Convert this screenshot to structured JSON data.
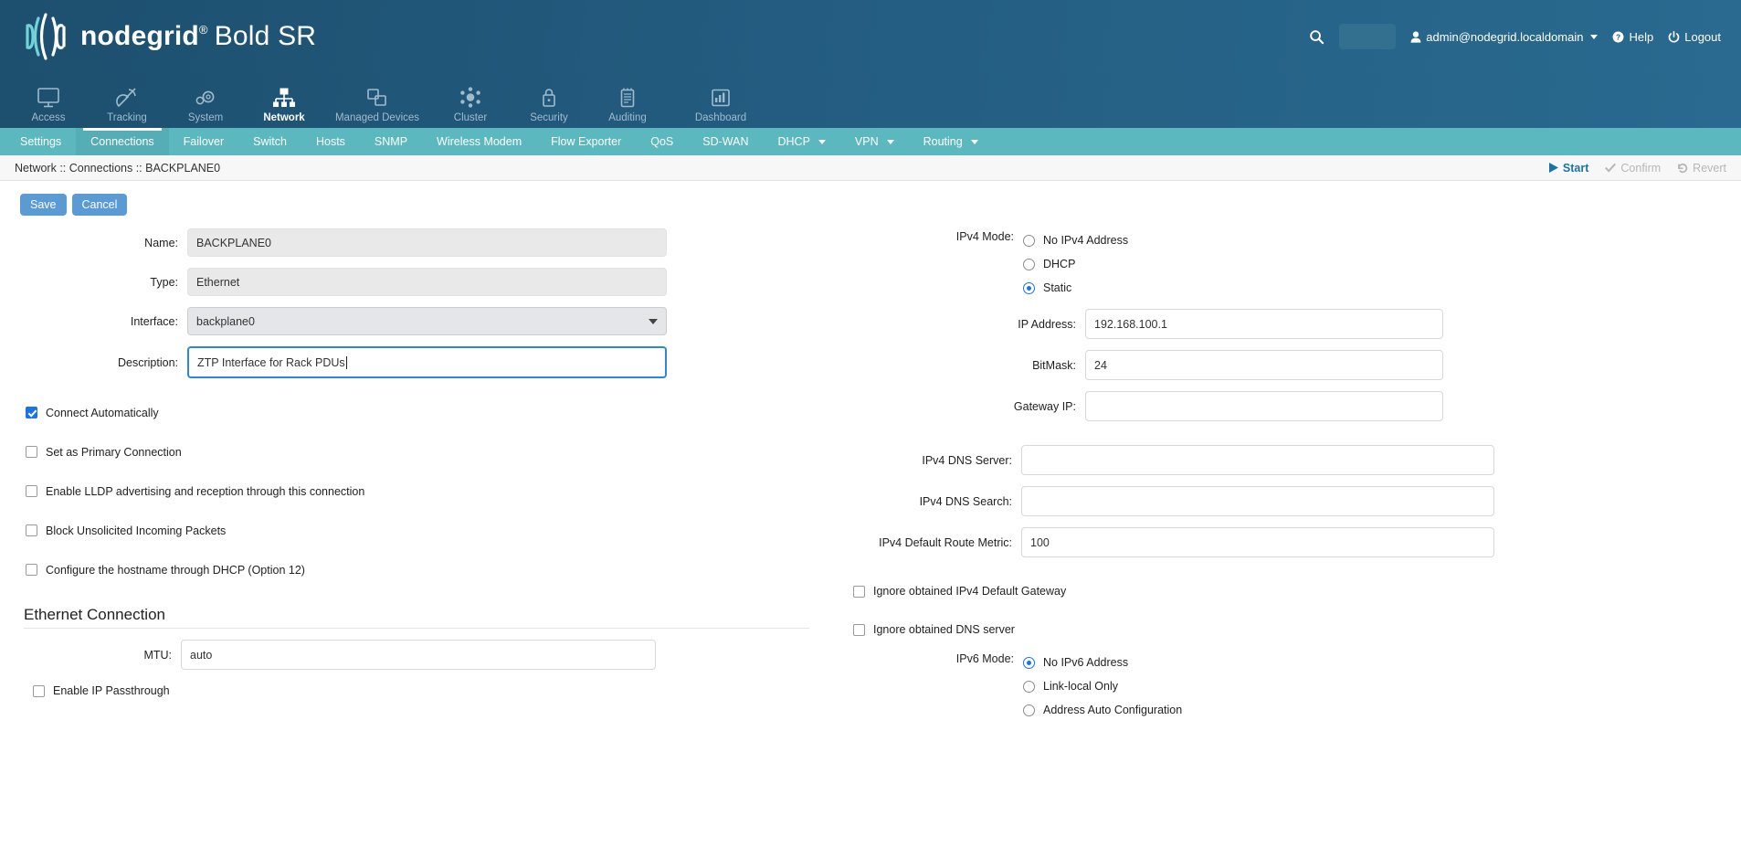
{
  "header": {
    "brand": "nodegrid",
    "registered": "®",
    "model": "Bold SR",
    "search_icon": "search-icon",
    "user": "admin@nodegrid.localdomain",
    "help": "Help",
    "logout": "Logout",
    "colors": {
      "header_bg": "#235c80",
      "subnav_bg": "#5bb8bf",
      "accent": "#5b9bd5",
      "link": "#1a73a8"
    }
  },
  "mainnav": {
    "items": [
      {
        "label": "Access",
        "icon": "monitor-icon",
        "active": false
      },
      {
        "label": "Tracking",
        "icon": "satellite-dish-icon",
        "active": false
      },
      {
        "label": "System",
        "icon": "gears-icon",
        "active": false
      },
      {
        "label": "Network",
        "icon": "network-tree-icon",
        "active": true
      },
      {
        "label": "Managed Devices",
        "icon": "stacked-squares-icon",
        "active": false
      },
      {
        "label": "Cluster",
        "icon": "cluster-nodes-icon",
        "active": false
      },
      {
        "label": "Security",
        "icon": "lock-icon",
        "active": false
      },
      {
        "label": "Auditing",
        "icon": "notepad-icon",
        "active": false
      },
      {
        "label": "Dashboard",
        "icon": "chart-report-icon",
        "active": false
      }
    ]
  },
  "subnav": {
    "items": [
      {
        "label": "Settings",
        "active": false,
        "dropdown": false
      },
      {
        "label": "Connections",
        "active": true,
        "dropdown": false
      },
      {
        "label": "Failover",
        "active": false,
        "dropdown": false
      },
      {
        "label": "Switch",
        "active": false,
        "dropdown": false
      },
      {
        "label": "Hosts",
        "active": false,
        "dropdown": false
      },
      {
        "label": "SNMP",
        "active": false,
        "dropdown": false
      },
      {
        "label": "Wireless Modem",
        "active": false,
        "dropdown": false
      },
      {
        "label": "Flow Exporter",
        "active": false,
        "dropdown": false
      },
      {
        "label": "QoS",
        "active": false,
        "dropdown": false
      },
      {
        "label": "SD-WAN",
        "active": false,
        "dropdown": false
      },
      {
        "label": "DHCP",
        "active": false,
        "dropdown": true
      },
      {
        "label": "VPN",
        "active": false,
        "dropdown": true
      },
      {
        "label": "Routing",
        "active": false,
        "dropdown": true
      }
    ]
  },
  "breadcrumb": {
    "text": "Network :: Connections :: BACKPLANE0",
    "actions": [
      {
        "label": "Start",
        "icon": "play-icon",
        "enabled": true
      },
      {
        "label": "Confirm",
        "icon": "check-icon",
        "enabled": false
      },
      {
        "label": "Revert",
        "icon": "undo-icon",
        "enabled": false
      }
    ]
  },
  "toolbar": {
    "save_label": "Save",
    "cancel_label": "Cancel"
  },
  "form_left": {
    "name": {
      "label": "Name:",
      "value": "BACKPLANE0",
      "readonly": true
    },
    "type": {
      "label": "Type:",
      "value": "Ethernet",
      "readonly": true
    },
    "interface": {
      "label": "Interface:",
      "value": "backplane0",
      "control": "select"
    },
    "description": {
      "label": "Description:",
      "value": "ZTP Interface for Rack PDUs",
      "focused": true
    },
    "checkboxes": [
      {
        "label": "Connect Automatically",
        "checked": true
      },
      {
        "label": "Set as Primary Connection",
        "checked": false
      },
      {
        "label": "Enable LLDP advertising and reception through this connection",
        "checked": false
      },
      {
        "label": "Block Unsolicited Incoming Packets",
        "checked": false
      },
      {
        "label": "Configure the hostname through DHCP (Option 12)",
        "checked": false
      }
    ],
    "ethernet_section": {
      "title": "Ethernet Connection",
      "mtu": {
        "label": "MTU:",
        "value": "auto"
      },
      "ip_passthrough": {
        "label": "Enable IP Passthrough",
        "checked": false
      }
    }
  },
  "form_right": {
    "ipv4_mode": {
      "label": "IPv4 Mode:",
      "options": [
        {
          "label": "No IPv4 Address",
          "selected": false
        },
        {
          "label": "DHCP",
          "selected": false
        },
        {
          "label": "Static",
          "selected": true
        }
      ]
    },
    "ip_address": {
      "label": "IP Address:",
      "value": "192.168.100.1"
    },
    "bitmask": {
      "label": "BitMask:",
      "value": "24"
    },
    "gateway_ip": {
      "label": "Gateway IP:",
      "value": ""
    },
    "ipv4_dns_server": {
      "label": "IPv4 DNS Server:",
      "value": ""
    },
    "ipv4_dns_search": {
      "label": "IPv4 DNS Search:",
      "value": ""
    },
    "ipv4_default_route_metric": {
      "label": "IPv4 Default Route Metric:",
      "value": "100"
    },
    "checkboxes": [
      {
        "label": "Ignore obtained IPv4 Default Gateway",
        "checked": false
      },
      {
        "label": "Ignore obtained DNS server",
        "checked": false
      }
    ],
    "ipv6_mode": {
      "label": "IPv6 Mode:",
      "options": [
        {
          "label": "No IPv6 Address",
          "selected": true
        },
        {
          "label": "Link-local Only",
          "selected": false
        },
        {
          "label": "Address Auto Configuration",
          "selected": false
        }
      ]
    }
  }
}
